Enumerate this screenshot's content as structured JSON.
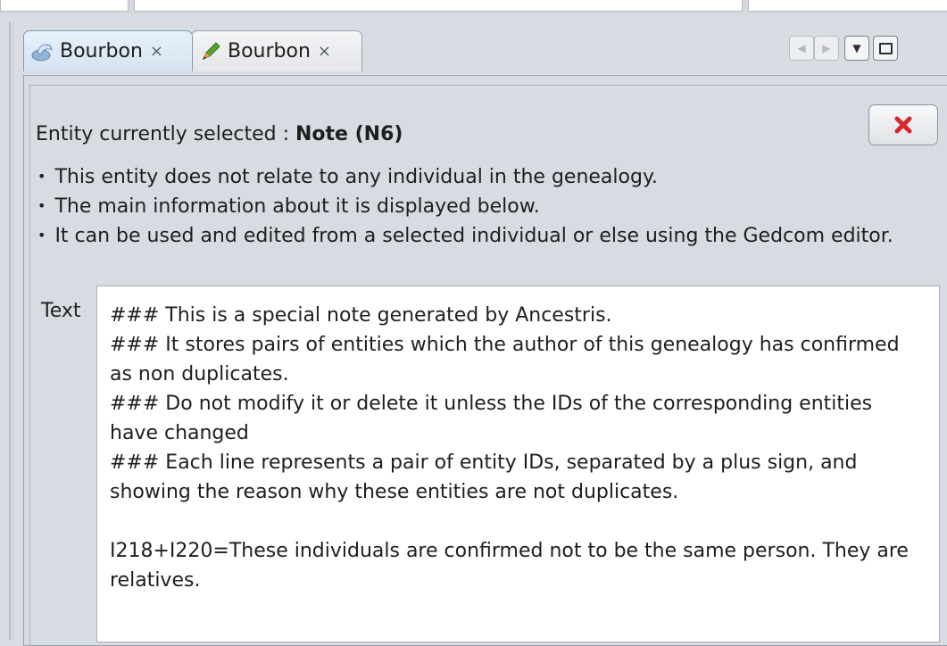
{
  "tabs": [
    {
      "label": "Bourbon",
      "icon": "genealogy-icon",
      "active": true
    },
    {
      "label": "Bourbon",
      "icon": "edit-pencil-icon",
      "active": false
    }
  ],
  "tab_close_glyph": "×",
  "tab_controls": [
    "scroll-left",
    "scroll-right",
    "tab-list-dropdown",
    "maximize"
  ],
  "entity": {
    "prefix": "Entity currently selected : ",
    "name": "Note (N6)"
  },
  "info_bullets": [
    "This entity does not relate to any individual in the genealogy.",
    "The main information about it is displayed below.",
    "It can be used and edited from a selected individual or else using the Gedcom editor."
  ],
  "text_field": {
    "label": "Text",
    "value": "### This is a special note generated by Ancestris.\n### It stores pairs of entities which the author of this genealogy has confirmed as non duplicates.\n### Do not modify it or delete it unless the IDs of the corresponding entities have changed\n### Each line represents a pair of entity IDs, separated by a plus sign, and showing the reason why these entities are not duplicates.\n\nI218+I220=These individuals are confirmed not to be the same person. They are relatives."
  },
  "colors": {
    "background": "#d9dde3",
    "active_tab": "#e2edf8",
    "delete_icon": "#d9262b",
    "pencil_green": "#5aa02c",
    "pencil_tip": "#e8b04a"
  }
}
